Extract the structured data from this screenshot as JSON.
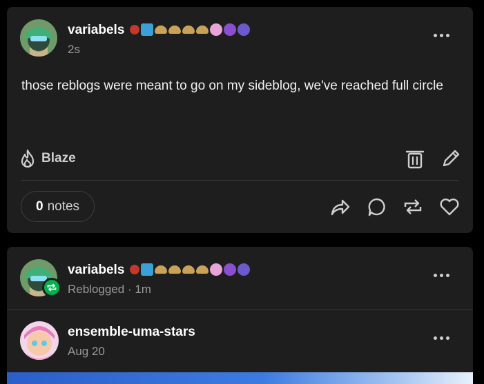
{
  "post1": {
    "username": "variabels",
    "timestamp": "2s",
    "body": "those reblogs were meant to go on my sideblog, we've reached full circle",
    "blaze_label": "Blaze",
    "notes_count": "0",
    "notes_label": "notes"
  },
  "post2": {
    "username": "variabels",
    "reblog_meta": "Reblogged · 1m",
    "original_username": "ensemble-uma-stars",
    "original_date": "Aug 20"
  },
  "badges": [
    "red-badge",
    "blue-ribbon-badge",
    "hat-badge",
    "hat-badge",
    "hat-badge",
    "hat-badge",
    "pink-badge",
    "purple-paw-badge",
    "purple-face-badge"
  ],
  "colors": {
    "background": "#000000",
    "card": "#1e1e1e",
    "muted": "#9a9a9a",
    "reblog_green": "#00b34f"
  }
}
